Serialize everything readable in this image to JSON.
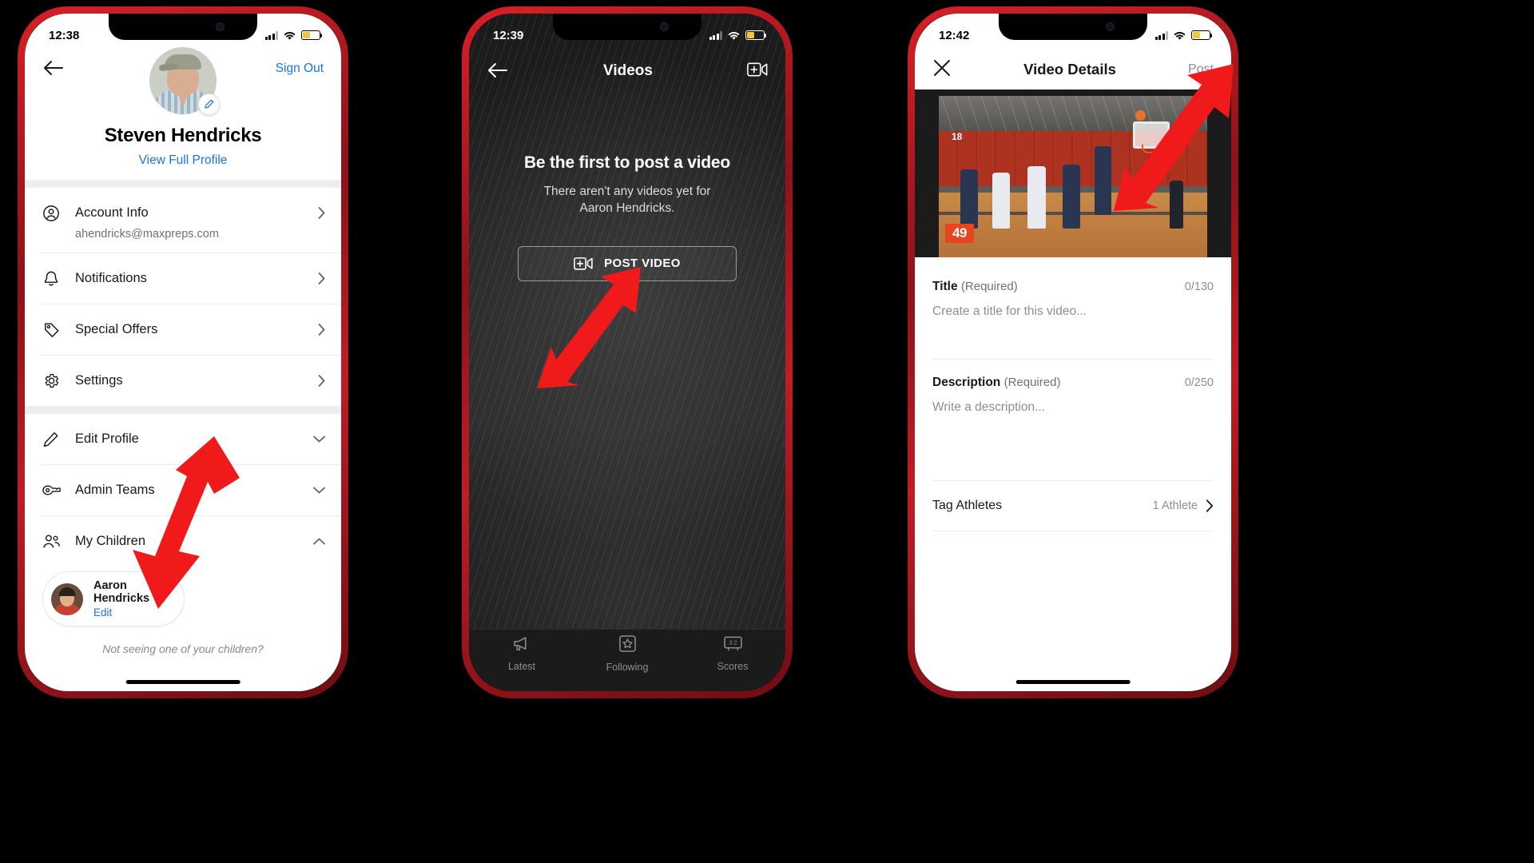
{
  "phone1": {
    "status": {
      "time": "12:38",
      "battery_icon": "battery-icon",
      "wifi_icon": "wifi-icon",
      "signal_icon": "cellular-icon"
    },
    "nav": {
      "back_icon": "back-arrow-icon",
      "sign_out": "Sign Out"
    },
    "profile": {
      "avatar_alt": "avatar",
      "edit_badge_icon": "pencil-icon",
      "name": "Steven Hendricks",
      "view_full_profile": "View Full Profile"
    },
    "menu": [
      {
        "label": "Account Info",
        "icon": "user-circle-icon",
        "sub": "ahendricks@maxpreps.com",
        "chevron": "chevron-right-icon"
      },
      {
        "label": "Notifications",
        "icon": "bell-icon",
        "sub": "",
        "chevron": "chevron-right-icon"
      },
      {
        "label": "Special Offers",
        "icon": "tag-icon",
        "sub": "",
        "chevron": "chevron-right-icon"
      },
      {
        "label": "Settings",
        "icon": "gear-icon",
        "sub": "",
        "chevron": "chevron-right-icon"
      }
    ],
    "menu2": [
      {
        "label": "Edit Profile",
        "icon": "pencil-icon",
        "chevron": "chevron-down-icon"
      },
      {
        "label": "Admin Teams",
        "icon": "whistle-icon",
        "chevron": "chevron-down-icon"
      },
      {
        "label": "My Children",
        "icon": "users-icon",
        "chevron": "chevron-up-icon"
      }
    ],
    "child": {
      "name": "Aaron Hendricks",
      "edit": "Edit",
      "avatar_alt": "child-avatar"
    },
    "footer_note": "Not seeing one of your children?"
  },
  "phone2": {
    "status": {
      "time": "12:39"
    },
    "nav": {
      "back_icon": "back-arrow-icon",
      "title": "Videos",
      "add_video_icon": "add-video-icon"
    },
    "empty": {
      "heading": "Be the first to post a video",
      "body_line1": "There aren't any videos yet for",
      "body_line2": "Aaron Hendricks.",
      "button_label": "POST VIDEO",
      "button_icon": "add-video-icon"
    },
    "tabs": [
      {
        "label": "Latest",
        "icon": "megaphone-icon"
      },
      {
        "label": "Following",
        "icon": "star-box-icon"
      },
      {
        "label": "Scores",
        "icon": "scoreboard-icon"
      }
    ]
  },
  "phone3": {
    "status": {
      "time": "12:42"
    },
    "nav": {
      "close_icon": "close-icon",
      "title": "Video Details",
      "post": "Post"
    },
    "video_thumb": {
      "alt": "basketball-game-thumbnail",
      "score_overlay": "49",
      "jersey_number": "18"
    },
    "fields": [
      {
        "label": "Title",
        "required": "(Required)",
        "count": "0/130",
        "placeholder": "Create a title for this video..."
      },
      {
        "label": "Description",
        "required": "(Required)",
        "count": "0/250",
        "placeholder": "Write a description..."
      }
    ],
    "tag_athletes": {
      "label": "Tag Athletes",
      "value": "1 Athlete",
      "chevron": "chevron-right-icon"
    }
  },
  "annotations": {
    "arrow_color": "#f01a1a",
    "arrows": [
      {
        "name": "arrow-to-my-children",
        "target": "My Children / child card"
      },
      {
        "name": "arrow-to-post-video",
        "target": "POST VIDEO button"
      },
      {
        "name": "arrow-to-post",
        "target": "Post button"
      }
    ]
  }
}
